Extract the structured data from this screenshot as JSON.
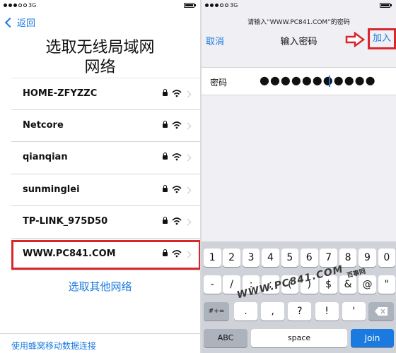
{
  "left": {
    "status": {
      "carrier": "3G"
    },
    "back_label": "返回",
    "title_line1": "选取无线局域网",
    "title_line2": "网络",
    "networks": [
      {
        "name": "HOME-ZFYZZC"
      },
      {
        "name": "Netcore"
      },
      {
        "name": "qianqian"
      },
      {
        "name": "sunminglei"
      },
      {
        "name": "TP-LINK_975D50"
      },
      {
        "name": "WWW.PC841.COM"
      }
    ],
    "highlighted_network": "WWW.PC841.COM",
    "other_network": "选取其他网络",
    "cellular": "使用蜂窝移动数据连接"
  },
  "right": {
    "status": {
      "carrier": "3G"
    },
    "prompt": "请输入“WWW.PC841.COM”的密码",
    "cancel": "取消",
    "title": "输入密码",
    "join": "加入",
    "password_label": "密码",
    "password_value": "●●●●●●●●●●●",
    "keyboard": {
      "row1": [
        "1",
        "2",
        "3",
        "4",
        "5",
        "6",
        "7",
        "8",
        "9",
        "0"
      ],
      "row2": [
        "-",
        "/",
        ":",
        ";",
        "(",
        ")",
        "$",
        "&",
        "@",
        "\""
      ],
      "row3_left": "#+=",
      "row3": [
        ".",
        ",",
        "?",
        "!",
        "'"
      ],
      "abc": "ABC",
      "space": "space",
      "join_key": "Join"
    }
  },
  "watermark": {
    "text": "WWW.PC841.COM",
    "brand": "百事网"
  },
  "colors": {
    "accent": "#1a7ae0",
    "highlight": "#d9262c",
    "keyboard_bg": "#cfd3d9"
  }
}
